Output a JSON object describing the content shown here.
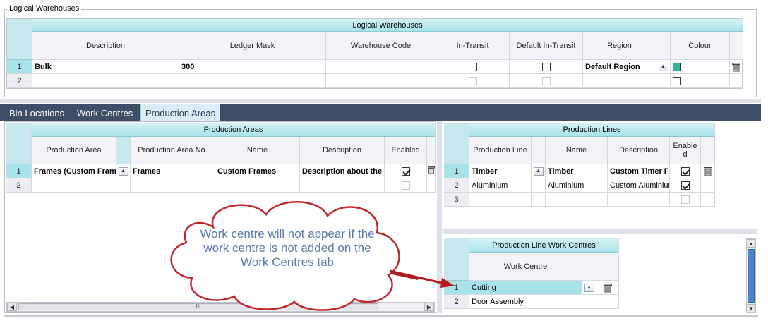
{
  "group": {
    "title": "Logical Warehouses"
  },
  "warehouses": {
    "band": "Logical Warehouses",
    "columns": [
      "Description",
      "Ledger Mask",
      "Warehouse Code",
      "In-Transit",
      "Default In-Transit",
      "Region",
      "Colour"
    ],
    "rows": [
      {
        "num": "1",
        "description": "Bulk",
        "ledger_mask": "300",
        "warehouse_code": "",
        "region": "Default Region",
        "colour": "#2bb6a8"
      },
      {
        "num": "2",
        "description": "",
        "ledger_mask": "",
        "warehouse_code": "",
        "region": ""
      }
    ]
  },
  "tabs": [
    "Bin Locations",
    "Work Centres",
    "Production Areas"
  ],
  "active_tab": "Production Areas",
  "areas": {
    "band": "Production Areas",
    "columns": [
      "Production Area",
      "Production Area No.",
      "Name",
      "Description",
      "Enabled"
    ],
    "rows": [
      {
        "num": "1",
        "area": "Frames (Custom Fram",
        "no": "Frames",
        "name": "Custom Frames",
        "description": "Description about the",
        "enabled": true
      },
      {
        "num": "2",
        "area": "",
        "no": "",
        "name": "",
        "description": "",
        "enabled": false
      }
    ],
    "scroll_mid": "III"
  },
  "lines": {
    "band": "Production Lines",
    "columns": [
      "Production Line",
      "Name",
      "Description",
      "Enabled"
    ],
    "rows": [
      {
        "num": "1",
        "line": "Timber",
        "name": "Timber",
        "description": "Custom Timer F",
        "enabled": true
      },
      {
        "num": "2",
        "line": "Aluminium",
        "name": "Aluminium",
        "description": "Custom Aluminium",
        "enabled": true
      },
      {
        "num": "3",
        "line": "",
        "name": "",
        "description": "",
        "enabled": false
      }
    ]
  },
  "work_centres": {
    "band": "Production Line Work Centres",
    "column": "Work Centre",
    "rows": [
      {
        "num": "1",
        "name": "Cutting"
      },
      {
        "num": "2",
        "name": "Door Assembly"
      }
    ]
  },
  "callout": {
    "text": "Work centre will not appear if the work centre is not added on the Work Centres tab"
  },
  "colors": {
    "accent": "#a9e3ea",
    "tabbar": "#3e4e66",
    "callout_border": "#c0282d",
    "arrow": "#b4191e",
    "callout_text": "#5a7ba6"
  },
  "icons": [
    "up-arrow-icon",
    "trash-icon",
    "scroll-left-icon",
    "scroll-right-icon",
    "scroll-up-icon",
    "scroll-down-icon"
  ]
}
